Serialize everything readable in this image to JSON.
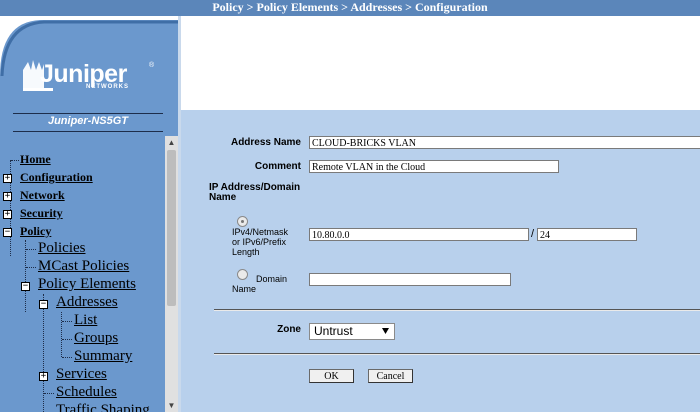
{
  "breadcrumb": "Policy > Policy Elements > Addresses > Configuration",
  "brand": {
    "logo_text": "Juniper",
    "logo_sub": "NETWORKS",
    "reg": "®",
    "device_name": "Juniper-NS5GT"
  },
  "nav": {
    "home": "Home",
    "configuration": "Configuration",
    "network": "Network",
    "security": "Security",
    "policy": "Policy",
    "policies": "Policies",
    "mcast_policies": "MCast Policies",
    "policy_elements": "Policy Elements",
    "addresses": "Addresses",
    "list": "List",
    "groups": "Groups",
    "summary": "Summary",
    "services": "Services",
    "schedules": "Schedules",
    "traffic_shaping": "Traffic Shaping"
  },
  "toggles": {
    "plus": "+",
    "minus": "−"
  },
  "form": {
    "address_name_label": "Address Name",
    "address_name_value": "CLOUD-BRICKS VLAN",
    "comment_label": "Comment",
    "comment_value": "Remote VLAN in the Cloud",
    "ip_section_label_1": "IP Address/Domain",
    "ip_section_label_2": "Name",
    "ipv4_label_1": "IPv4/Netmask",
    "ipv4_label_2": "or IPv6/Prefix",
    "ipv4_label_3": "Length",
    "ip_value": "10.80.0.0",
    "slash": "/",
    "prefix_value": "24",
    "domain_label_1": "Domain",
    "domain_label_2": "Name",
    "domain_value": "",
    "zone_label": "Zone",
    "zone_value": "Untrust",
    "ok_label": "OK",
    "cancel_label": "Cancel"
  },
  "scroll": {
    "up": "▲",
    "down": "▼"
  },
  "colors": {
    "banner": "#5b86ba",
    "sidebar": "#6b98cd",
    "form_bg": "#b8d0ec"
  }
}
